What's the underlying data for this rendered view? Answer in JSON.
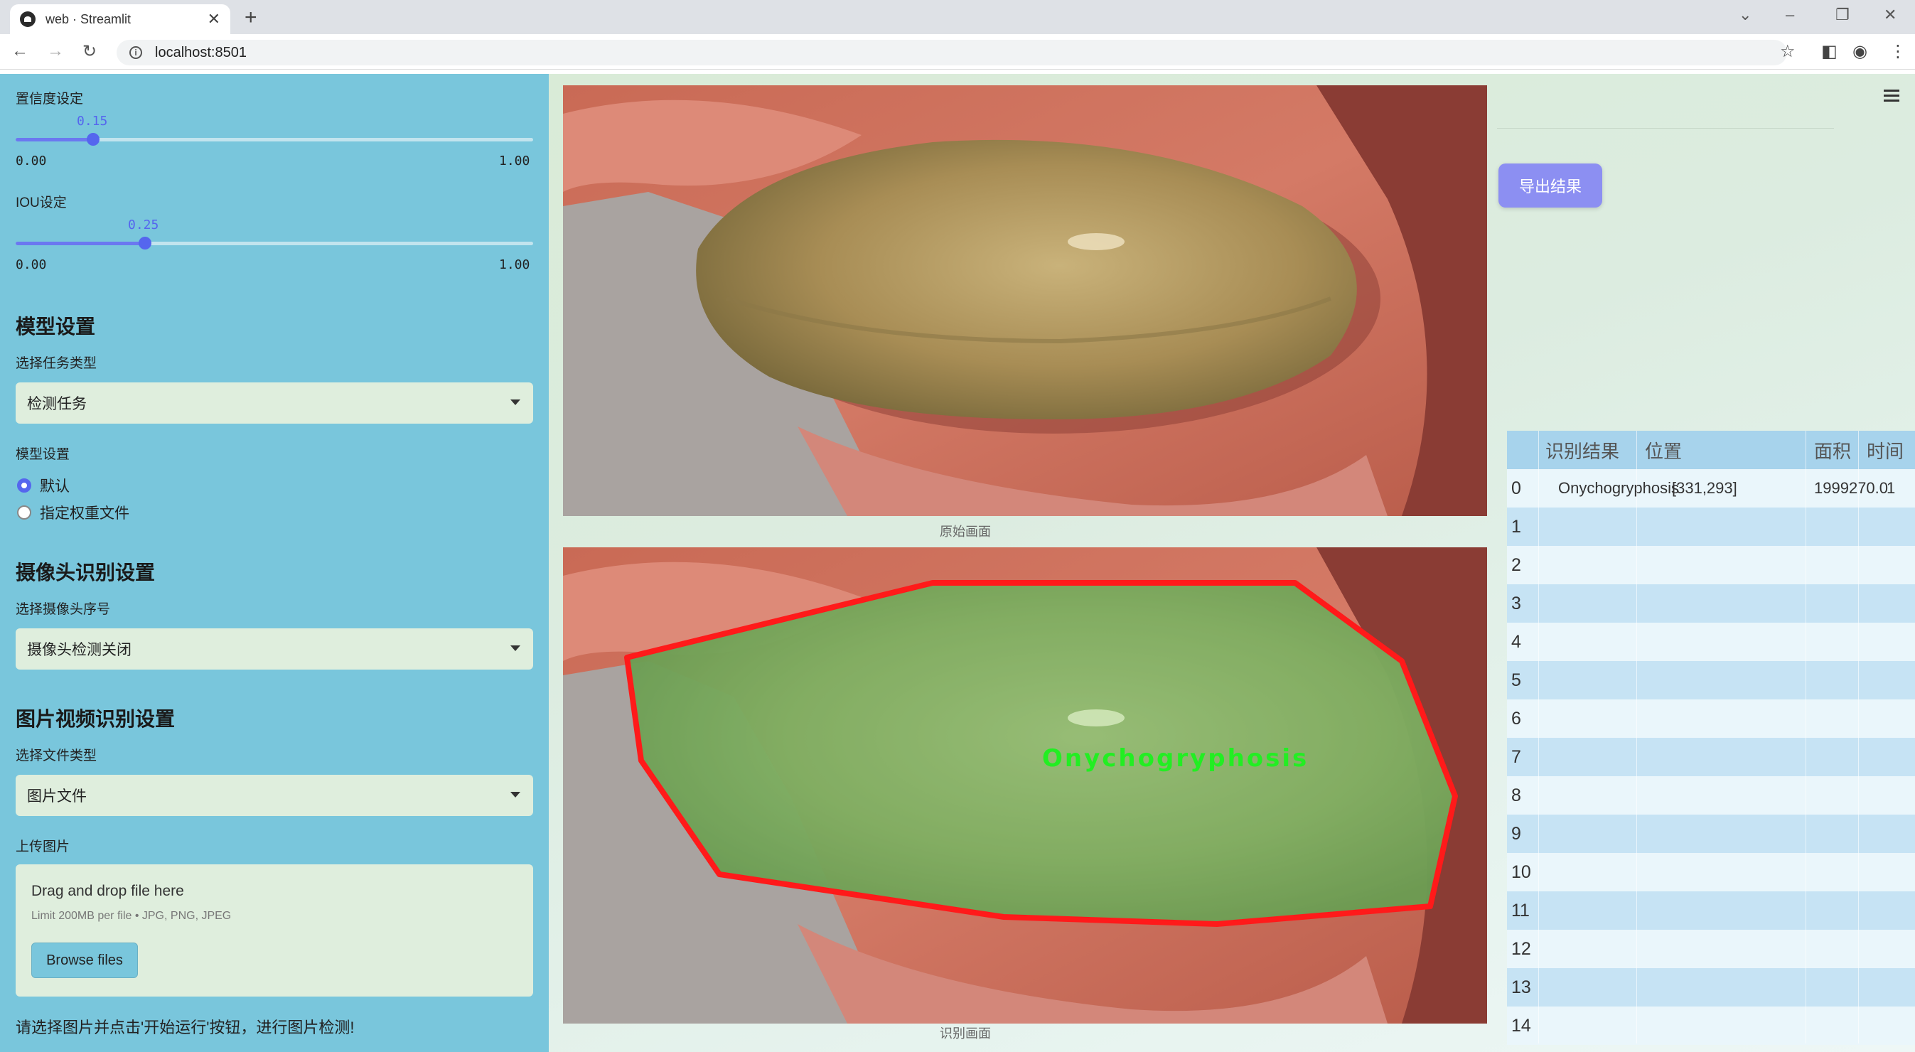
{
  "browser": {
    "tab_title": "web · Streamlit",
    "url": "localhost:8501"
  },
  "sidebar": {
    "confidence": {
      "label": "置信度设定",
      "value": "0.15",
      "min": "0.00",
      "max": "1.00",
      "fraction": 0.15
    },
    "iou": {
      "label": "IOU设定",
      "value": "0.25",
      "min": "0.00",
      "max": "1.00",
      "fraction": 0.25
    },
    "model_section": "模型设置",
    "task_type_label": "选择任务类型",
    "task_type_value": "检测任务",
    "model_label": "模型设置",
    "model_options": [
      "默认",
      "指定权重文件"
    ],
    "model_selected": "默认",
    "camera_section": "摄像头识别设置",
    "camera_label": "选择摄像头序号",
    "camera_value": "摄像头检测关闭",
    "media_section": "图片视频识别设置",
    "file_type_label": "选择文件类型",
    "file_type_value": "图片文件",
    "upload_label": "上传图片",
    "upload_title": "Drag and drop file here",
    "upload_limit": "Limit 200MB per file • JPG, PNG, JPEG",
    "browse_label": "Browse files",
    "hint": "请选择图片并点击'开始运行'按钮，进行图片检测!"
  },
  "main": {
    "original_caption": "原始画面",
    "result_caption": "识别画面",
    "detection_label": "Onychogryphosis",
    "export_label": "导出结果"
  },
  "table": {
    "headers": [
      "识别结果",
      "位置",
      "面积",
      "时间"
    ],
    "rows": [
      {
        "index": "0",
        "result": "Onychogryphosis",
        "position": "[331,293]",
        "area": "1999270.0",
        "time": "1"
      },
      {
        "index": "1"
      },
      {
        "index": "2"
      },
      {
        "index": "3"
      },
      {
        "index": "4"
      },
      {
        "index": "5"
      },
      {
        "index": "6"
      },
      {
        "index": "7"
      },
      {
        "index": "8"
      },
      {
        "index": "9"
      },
      {
        "index": "10"
      },
      {
        "index": "11"
      },
      {
        "index": "12"
      },
      {
        "index": "13"
      },
      {
        "index": "14"
      }
    ]
  },
  "colors": {
    "sidebar_bg": "#79c6dc",
    "accent": "#5566ee",
    "export_button": "#8c8ff2",
    "detection_box": "#ff1a1a",
    "detection_text": "#22ee22"
  }
}
